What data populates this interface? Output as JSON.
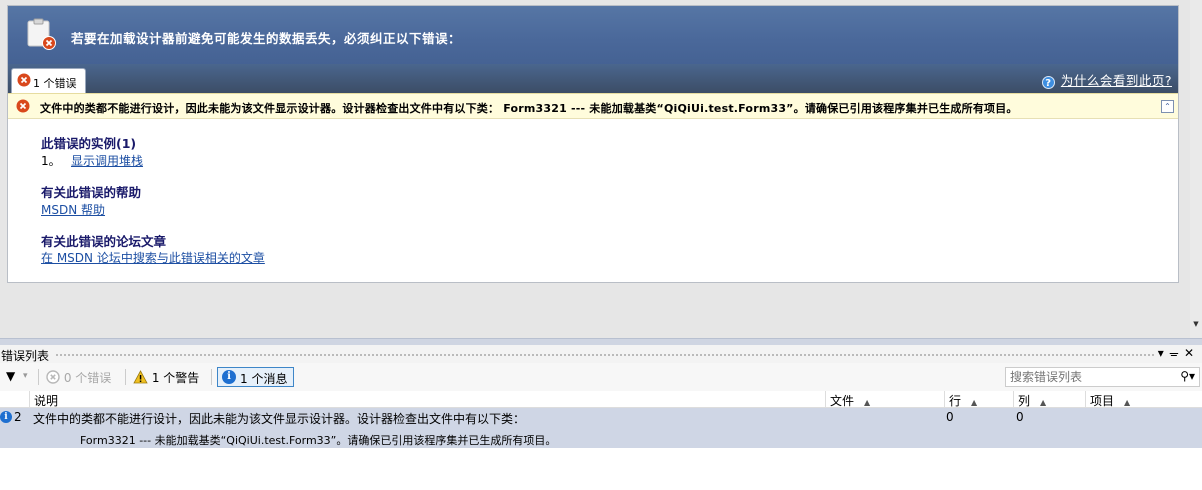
{
  "header": {
    "title": "若要在加载设计器前避免可能发生的数据丢失，必须纠正以下错误：",
    "tab_label": "1 个错误",
    "why_link": "为什么会看到此页?"
  },
  "error_message": "文件中的类都不能进行设计，因此未能为该文件显示设计器。设计器检查出文件中有以下类：  Form3321 --- 未能加载基类“QiQiUi.test.Form33”。请确保已引用该程序集并已生成所有项目。",
  "sections": {
    "instances": {
      "title": "此错误的实例(1)",
      "index": "1。",
      "link": "显示调用堆栈"
    },
    "help": {
      "title": "有关此错误的帮助",
      "link": "MSDN 帮助"
    },
    "forum": {
      "title": "有关此错误的论坛文章",
      "link": "在 MSDN 论坛中搜索与此错误相关的文章"
    }
  },
  "error_list": {
    "title": "错误列表",
    "errors_label": "0 个错误",
    "warnings_label": "1 个警告",
    "messages_label": "1 个消息",
    "search_placeholder": "搜索错误列表",
    "columns": {
      "description": "说明",
      "file": "文件",
      "line": "行",
      "column": "列",
      "project": "项目"
    },
    "rows": [
      {
        "index": "2",
        "description_line1": "文件中的类都不能进行设计，因此未能为该文件显示设计器。设计器检查出文件中有以下类：",
        "description_line2": "Form3321 --- 未能加载基类“QiQiUi.test.Form33”。请确保已引用该程序集并已生成所有项目。",
        "line": "0",
        "column": "0"
      }
    ]
  },
  "colors": {
    "header_blue": "#4a689a",
    "message_bg": "#fffcdc",
    "selected_row": "#cfd6e5",
    "link": "#1d4fa3"
  }
}
